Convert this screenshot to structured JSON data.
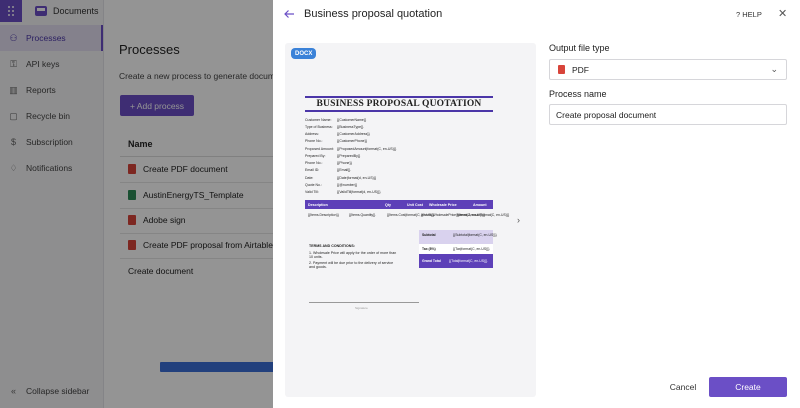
{
  "app": {
    "name": "Documents"
  },
  "sidebar": {
    "items": [
      {
        "label": "Processes",
        "icon": "processes-icon",
        "active": true
      },
      {
        "label": "API keys",
        "icon": "key-icon"
      },
      {
        "label": "Reports",
        "icon": "chart-icon"
      },
      {
        "label": "Recycle bin",
        "icon": "trash-icon"
      },
      {
        "label": "Subscription",
        "icon": "dollar-icon"
      },
      {
        "label": "Notifications",
        "icon": "bell-icon"
      }
    ],
    "collapse_label": "Collapse sidebar"
  },
  "main": {
    "title": "Processes",
    "subtitle": "Create a new process to generate docum",
    "add_button": "+ Add process",
    "column_name": "Name",
    "rows": [
      {
        "name": "Create PDF document",
        "type": "pdf"
      },
      {
        "name": "AustinEnergyTS_Template",
        "type": "xls"
      },
      {
        "name": "Adobe sign",
        "type": "pdf"
      },
      {
        "name": "Create PDF proposal from Airtable",
        "type": "pdf"
      },
      {
        "name": "Create document",
        "type": "doc"
      }
    ]
  },
  "panel": {
    "title": "Business proposal quotation",
    "help": "HELP",
    "badge": "DOCX",
    "output_label": "Output file type",
    "output_value": "PDF",
    "process_label": "Process name",
    "process_value": "Create proposal document",
    "cancel": "Cancel",
    "create": "Create"
  },
  "doc": {
    "title": "BUSINESS PROPOSAL QUOTATION",
    "fields": [
      {
        "k": "Customer Name:",
        "v": "{{CustomerName}}"
      },
      {
        "k": "Type of Business:",
        "v": "{{BusinessType}}"
      },
      {
        "k": "Address:",
        "v": "{{CustomerAddress}}"
      },
      {
        "k": "Phone No.:",
        "v": "{{CustomerPhone}}"
      },
      {
        "k": "Proposed Amount:",
        "v": "{{ProposedAmount|format(C, en-US)}}"
      },
      {
        "k": "Prepared By:",
        "v": "{{PreparedBy}}"
      },
      {
        "k": "Phone No.:",
        "v": "{{Phone}}"
      },
      {
        "k": "Email ID:",
        "v": "{{Email}}"
      },
      {
        "k": "Date:",
        "v": "{{Date|format(d, en-US)}}"
      },
      {
        "k": "Quote No.:",
        "v": "{{@number}}"
      },
      {
        "k": "Valid Till:",
        "v": "{{ValidTill|format(d, en-US)}}"
      }
    ],
    "table_head": [
      "Description",
      "Qty",
      "Unit Cost",
      "Wholesale Price",
      "Amount"
    ],
    "table_row": [
      "{{Items.Description}}",
      "{{Items.Quantity}}",
      "{{Items.Cost|format(C, en-US)}}",
      "{{Items.WholesalePrice|format(C, en-US)}}",
      "{{Items.Amount|format(C, en-US)}}"
    ],
    "subtotal_label": "Subtotal",
    "subtotal_value": "{{Subtotal|format(C, en-US)}}",
    "tax_label": "Tax (8%)",
    "tax_value": "{{Tax|format(C, en-US)}}",
    "grand_label": "Grand Total",
    "grand_value": "{{Total|format(C, en-US)}}",
    "terms_title": "TERMS AND CONDITIONS:",
    "terms": [
      "1. Wholesale Price will apply for the order of more than 10 units.",
      "2. Payment will be due prior to the delivery of service and goods."
    ],
    "signature": "Signature"
  },
  "colors": {
    "accent": "#6b4fc6",
    "doc_header": "#5d40b8",
    "badge": "#3b82d8"
  }
}
